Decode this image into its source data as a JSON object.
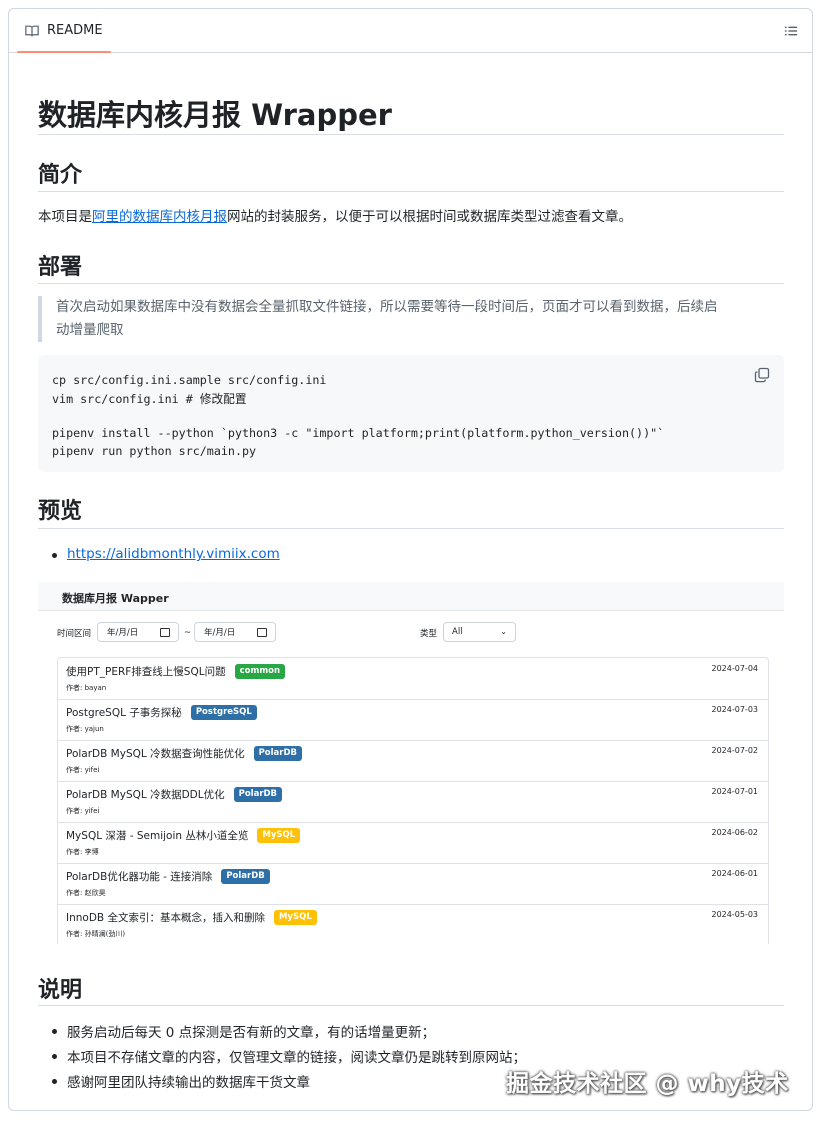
{
  "tab": {
    "label": "README"
  },
  "title": "数据库内核月报 Wrapper",
  "intro": {
    "heading": "简介",
    "prefix": "本项目是",
    "link": "阿里的数据库内核月报",
    "suffix": "网站的封装服务，以便于可以根据时间或数据库类型过滤查看文章。"
  },
  "deploy": {
    "heading": "部署",
    "quote_line1": "首次启动如果数据库中没有数据会全量抓取文件链接，所以需要等待一段时间后，页面才可以看到数据，后续启",
    "quote_line2": "动增量爬取",
    "code": [
      "cp src/config.ini.sample src/config.ini",
      "vim src/config.ini # 修改配置",
      "",
      "pipenv install --python `python3 -c \"import platform;print(platform.python_version())\"`",
      "pipenv run python src/main.py"
    ]
  },
  "preview": {
    "heading": "预览",
    "link": "https://alidbmonthly.vimiix.com",
    "app": {
      "title": "数据库月报 Wapper",
      "time_label": "时间区间",
      "date_placeholder": "年/月/日",
      "separator": "~",
      "type_label": "类型",
      "type_value": "All",
      "articles": [
        {
          "title": "使用PT_PERF排查线上慢SQL问题",
          "tag": "common",
          "author": "作者: bayan",
          "date": "2024-07-04"
        },
        {
          "title": "PostgreSQL 子事务探秘",
          "tag": "PostgreSQL",
          "author": "作者: yajun",
          "date": "2024-07-03"
        },
        {
          "title": "PolarDB MySQL 冷数据查询性能优化",
          "tag": "PolarDB",
          "author": "作者: yifei",
          "date": "2024-07-02"
        },
        {
          "title": "PolarDB MySQL 冷数据DDL优化",
          "tag": "PolarDB",
          "author": "作者: yifei",
          "date": "2024-07-01"
        },
        {
          "title": "MySQL 深潜 - Semijoin 丛林小道全览",
          "tag": "MySQL",
          "author": "作者: 李博",
          "date": "2024-06-02"
        },
        {
          "title": "PolarDB优化器功能 - 连接消除",
          "tag": "PolarDB",
          "author": "作者: 赵欣昊",
          "date": "2024-06-01"
        },
        {
          "title": "InnoDB 全文索引：基本概念，插入和删除",
          "tag": "MySQL",
          "author": "作者: 孙晴澜(劲川)",
          "date": "2024-05-03"
        }
      ]
    },
    "tag_colors": {
      "common": "#28a745",
      "PostgreSQL": "#2f6fa7",
      "PolarDB": "#2f6fa7",
      "MySQL": "#ffc107"
    }
  },
  "notes": {
    "heading": "说明",
    "items": [
      "服务启动后每天 0 点探测是否有新的文章，有的话增量更新；",
      "本项目不存储文章的内容，仅管理文章的链接，阅读文章仍是跳转到原网站；",
      "感谢阿里团队持续输出的数据库干货文章"
    ]
  },
  "watermark": "掘金技术社区 @ why技术"
}
